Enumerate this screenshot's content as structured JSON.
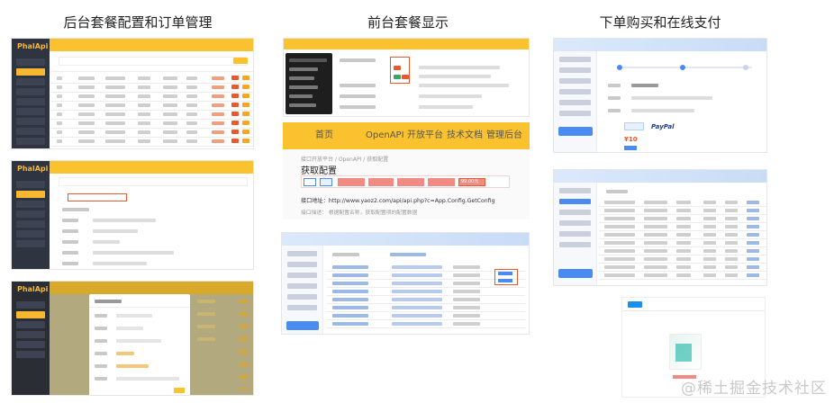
{
  "columns": [
    {
      "title": "后台套餐配置和订单管理"
    },
    {
      "title": "前台套餐显示"
    },
    {
      "title": "下单购买和在线支付"
    }
  ],
  "front": {
    "nav": [
      "首页",
      "OpenAPI",
      "开放平台",
      "技术文档",
      "管理后台"
    ],
    "breadcrumb": "接口开放平台 / OpenAPI / 获取配置",
    "heading": "获取配置",
    "price_tag": "99.00元",
    "address_label": "接口地址：http://www.yaoz2.com/api/api.php?c=App.Config.GetConfig",
    "desc_label": "接口描述：  根据配置名称，获取配置项的配置数据"
  },
  "pay": {
    "amount": "¥10",
    "paypal": "PayPal"
  },
  "watermark": "@稀土掘金技术社区",
  "colors": {
    "accent": "#f9c22e",
    "brand_red": "#e9592f",
    "blue": "#4a8bf1"
  }
}
